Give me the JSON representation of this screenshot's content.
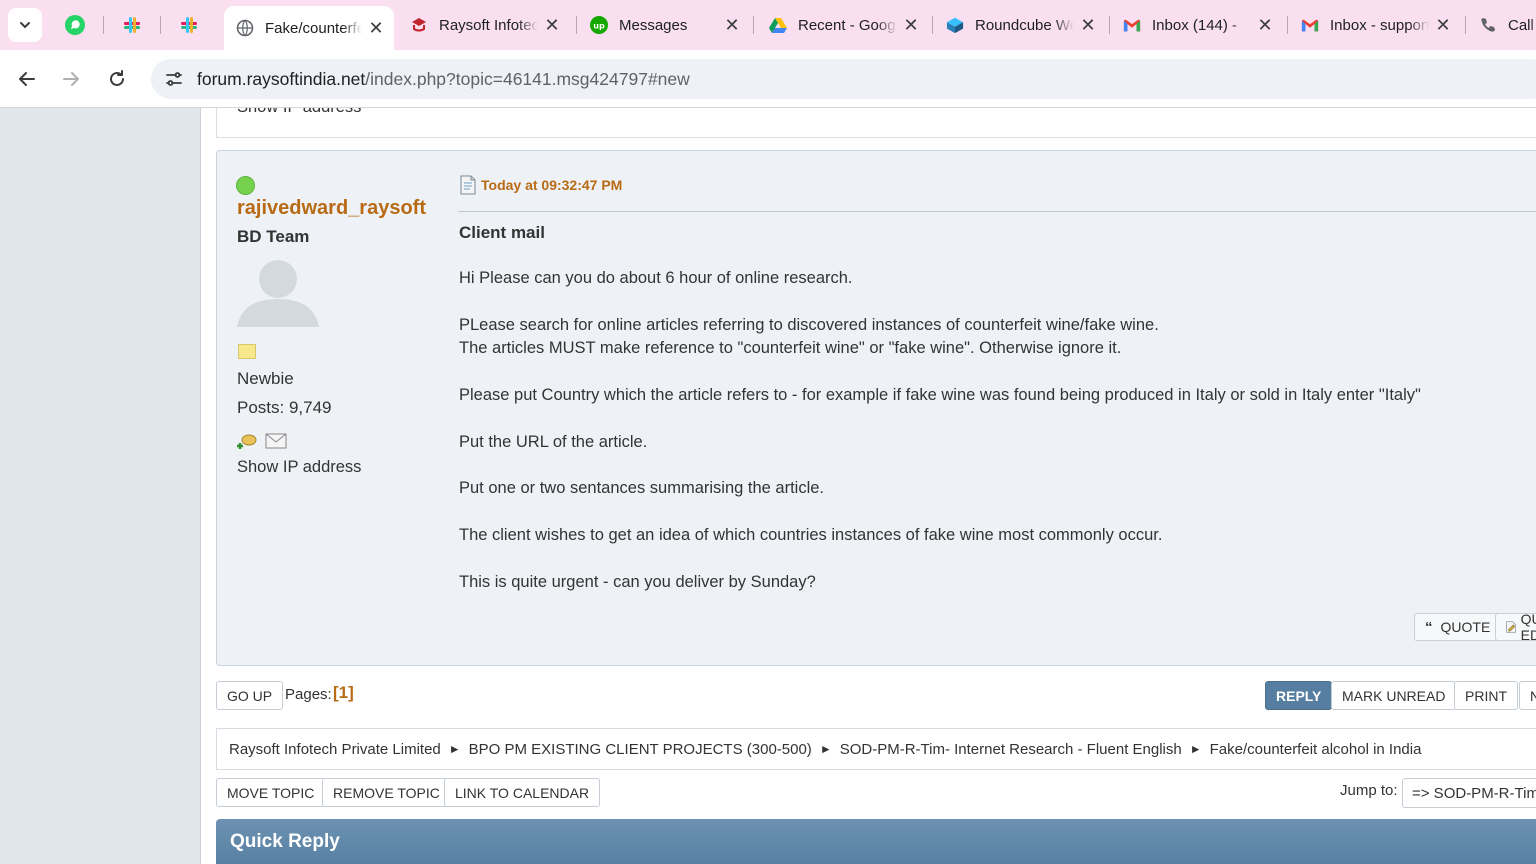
{
  "browser": {
    "tabs": [
      {
        "title": "Fake/counterfeit alcohol in India",
        "active": true
      },
      {
        "title": "Raysoft Infotech"
      },
      {
        "title": "Messages"
      },
      {
        "title": "Recent - Google Drive"
      },
      {
        "title": "Roundcube Webmail"
      },
      {
        "title": "Inbox (144) - "
      },
      {
        "title": "Inbox - support"
      },
      {
        "title": "Call"
      }
    ],
    "url_host": "forum.raysoftindia.net",
    "url_path": "/index.php?topic=46141.msg424797#new"
  },
  "previous_post": {
    "show_ip": "Show IP address"
  },
  "post": {
    "username": "rajivedward_raysoft",
    "group": "BD Team",
    "rank": "Newbie",
    "posts": "Posts: 9,749",
    "show_ip": "Show IP address",
    "date": "Today at 09:32:47 PM",
    "subject": "Client mail",
    "body": [
      "Hi Please can you do about 6 hour of online research.",
      "PLease search for online articles referring to discovered instances of counterfeit wine/fake wine.",
      "The articles MUST make reference to \"counterfeit wine\" or \"fake wine\". Otherwise ignore it.",
      "Please put Country which the article refers to - for example if fake wine was found being produced in Italy or sold in Italy enter \"Italy\"",
      "Put the URL of the article.",
      "Put one or two sentances summarising the article.",
      "The client wishes to get an idea of which countries instances of fake wine most commonly occur.",
      "This is quite urgent - can you deliver by Sunday?"
    ],
    "quote_label": "QUOTE",
    "quick_edit_label": "QUICK EDIT"
  },
  "pagination": {
    "go_up": "GO UP",
    "pages_label": "Pages:",
    "pages_value": "[1]",
    "reply": "REPLY",
    "mark_unread": "MARK UNREAD",
    "print": "PRINT",
    "notify": "NOTIFY"
  },
  "breadcrumb": [
    "Raysoft Infotech Private Limited",
    "BPO PM EXISTING CLIENT PROJECTS (300-500)",
    "SOD-PM-R-Tim- Internet Research - Fluent English",
    "Fake/counterfeit alcohol in India"
  ],
  "moderation": {
    "move_topic": "MOVE TOPIC",
    "remove_topic": "REMOVE TOPIC",
    "link_to_calendar": "LINK TO CALENDAR",
    "jump_label": "Jump to:",
    "jump_value": "=> SOD-PM-R-Tim- Internet Research - Fluent English"
  },
  "quick_reply": {
    "title": "Quick Reply"
  },
  "colors": {
    "accent": "#557ea0",
    "username": "#b86a14",
    "online": "#76d14f"
  }
}
